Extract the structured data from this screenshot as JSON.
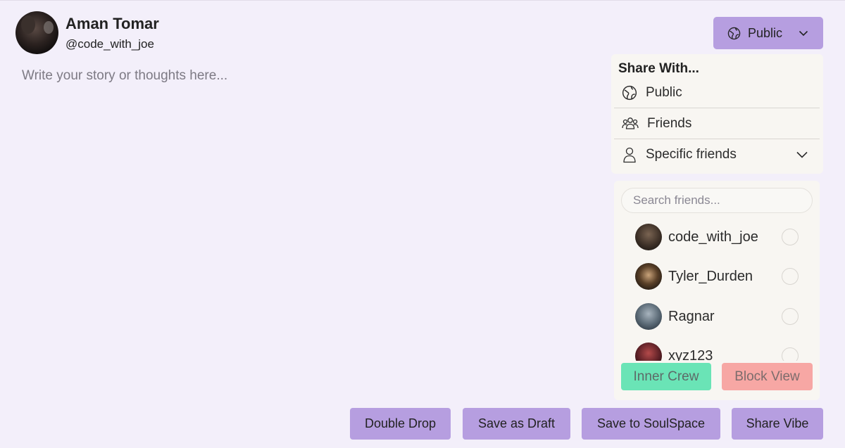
{
  "profile": {
    "name": "Aman Tomar",
    "handle": "@code_with_joe"
  },
  "composer": {
    "placeholder": "Write your story or thoughts here..."
  },
  "privacy": {
    "selected": "Public",
    "icon": "globe-icon"
  },
  "share_menu": {
    "title": "Share With...",
    "options": [
      {
        "label": "Public",
        "icon": "globe-icon"
      },
      {
        "label": "Friends",
        "icon": "users-icon"
      },
      {
        "label": "Specific friends",
        "icon": "user-icon"
      }
    ]
  },
  "friends_picker": {
    "search_placeholder": "Search friends...",
    "friends": [
      {
        "name": "code_with_joe",
        "selected": false
      },
      {
        "name": "Tyler_Durden",
        "selected": false
      },
      {
        "name": "Ragnar",
        "selected": false
      },
      {
        "name": "xyz123",
        "selected": false
      }
    ],
    "inner_crew_label": "Inner Crew",
    "block_view_label": "Block View"
  },
  "actions": {
    "double_drop": "Double Drop",
    "save_draft": "Save as Draft",
    "save_soulspace": "Save to SoulSpace",
    "share_vibe": "Share Vibe"
  },
  "colors": {
    "page_bg": "#f3effa",
    "accent": "#b69ee0",
    "panel_bg": "#f8f6f2",
    "inner_crew": "#6ae4b6",
    "block_view": "#f7a7a4"
  }
}
